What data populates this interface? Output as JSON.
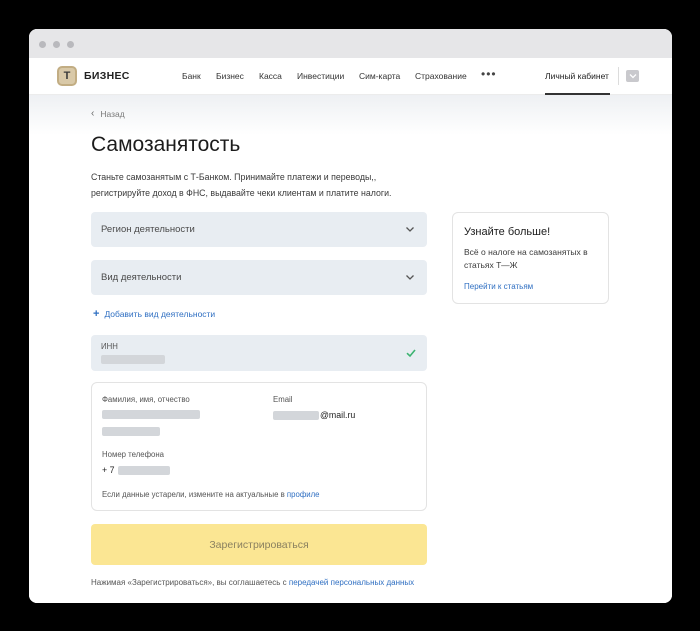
{
  "nav": {
    "logo_mark": "Т",
    "logo_text": "БИЗНЕС",
    "links": [
      "Банк",
      "Бизнес",
      "Касса",
      "Инвестиции",
      "Сим-карта",
      "Страхование"
    ],
    "more": "•••",
    "cabinet": "Личный кабинет"
  },
  "page": {
    "back_label": "Назад",
    "title": "Самозанятость",
    "description": "Станьте самозанятым с Т-Банком. Принимайте платежи и переводы,, регистрируйте доход в ФНС, выдавайте чеки клиентам и платите налоги."
  },
  "form": {
    "region_placeholder": "Регион деятельности",
    "activity_placeholder": "Вид деятельности",
    "add_activity_label": "Добавить вид деятельности",
    "inn_label": "ИНН",
    "fio_label": "Фамилия, имя, отчество",
    "email_label": "Email",
    "email_value_suffix": "@mail.ru",
    "phone_label": "Номер телефона",
    "phone_prefix": "+ 7",
    "note_text": "Если данные устарели, измените на актуальные в ",
    "note_link": "профиле",
    "submit_label": "Зарегистрироваться",
    "agree_text": "Нажимая «Зарегистрироваться», вы соглашаетесь с ",
    "agree_link": "передачей персональных данных"
  },
  "side_card": {
    "title": "Узнайте больше!",
    "text": "Всё о налоге на самозанятых в статьях Т—Ж",
    "link": "Перейти к статьям"
  },
  "colors": {
    "accent_link": "#2f6fc2",
    "submit_bg": "#fbe693",
    "field_bg": "#e8edf2",
    "check_green": "#3cb371"
  }
}
